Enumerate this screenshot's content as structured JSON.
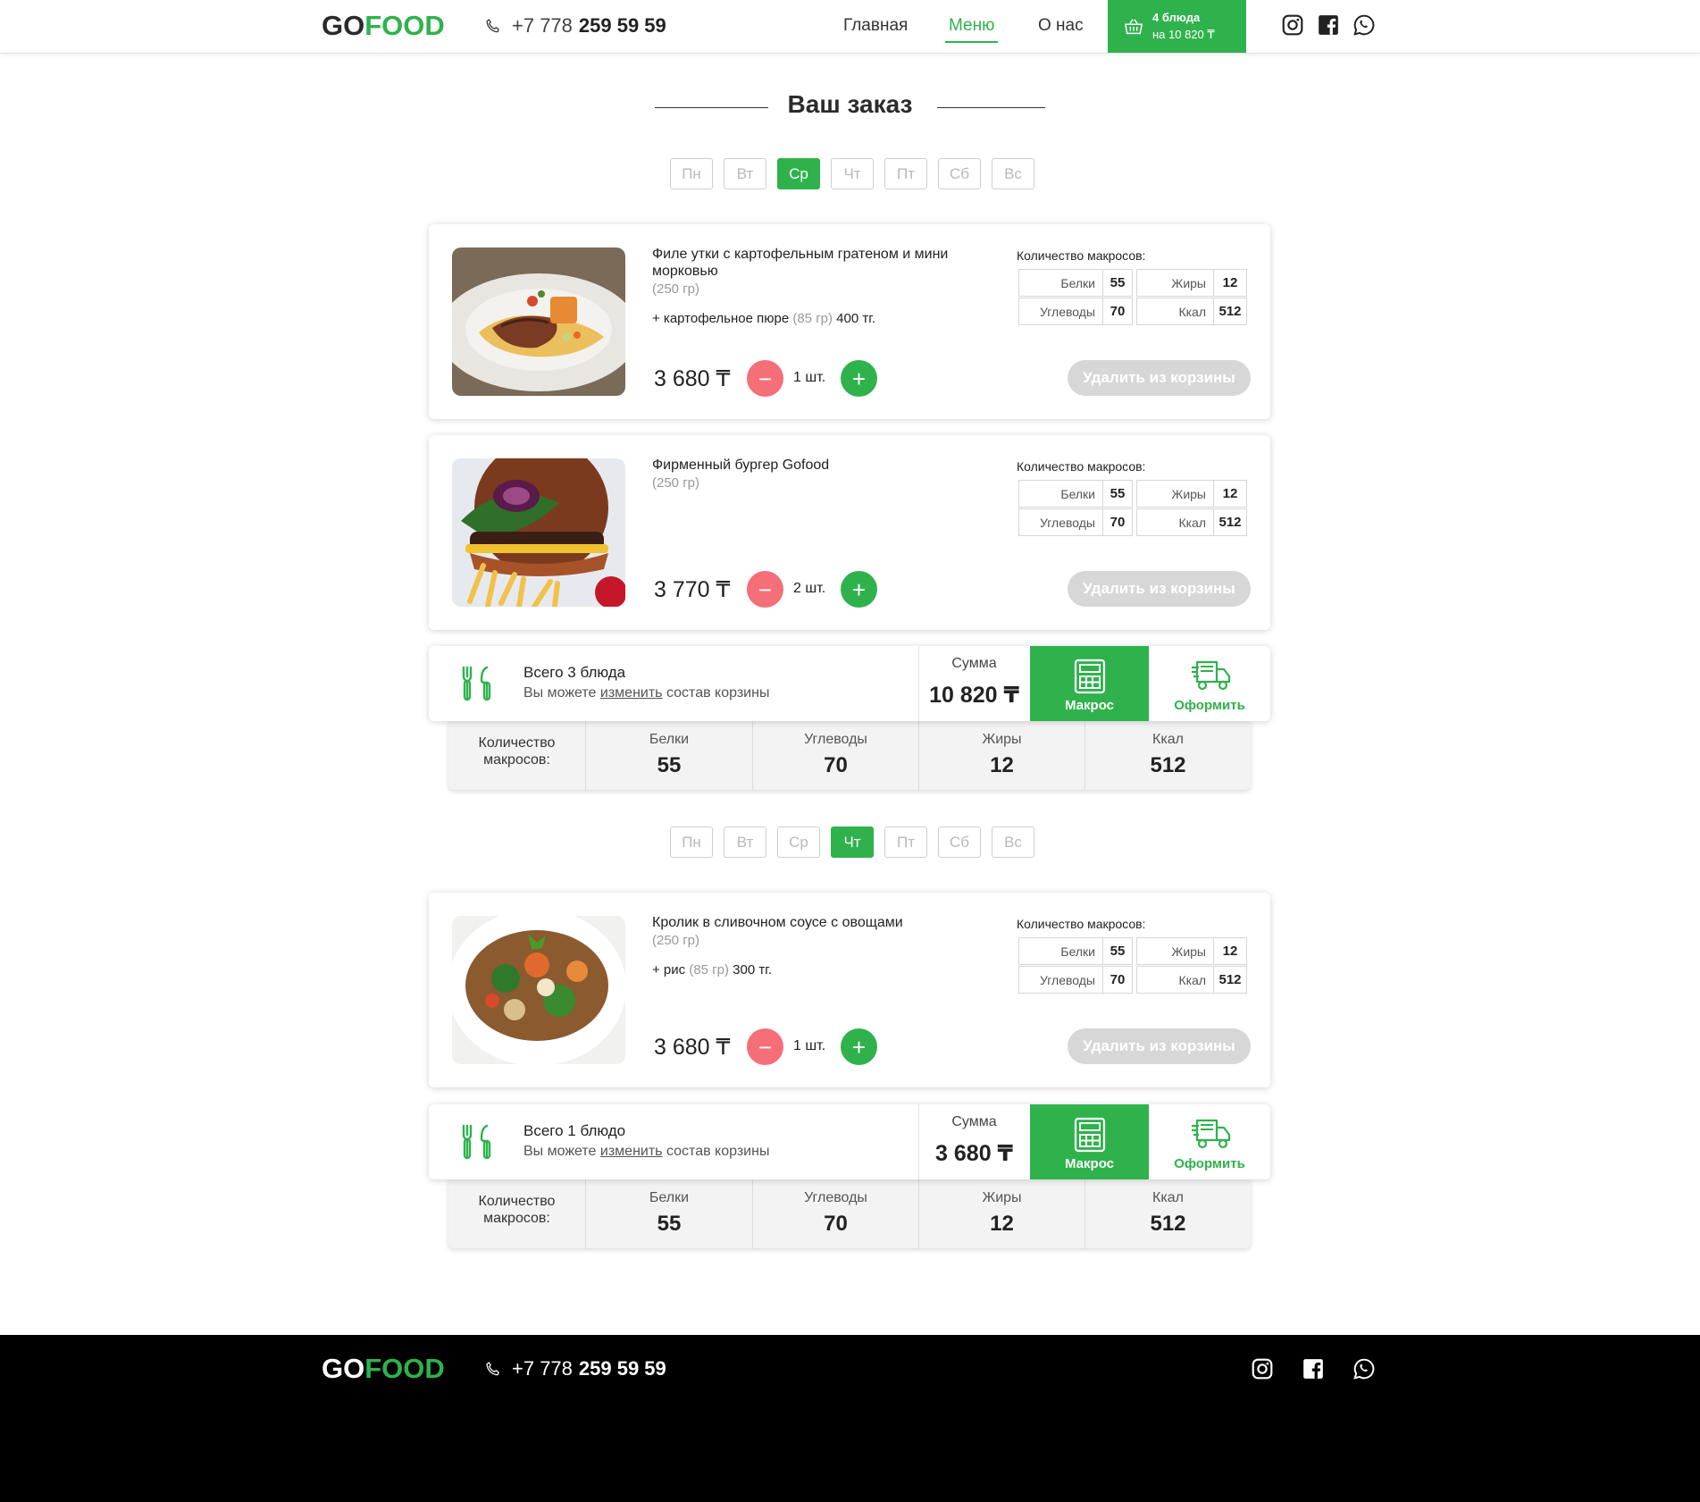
{
  "header": {
    "logo_go": "GO",
    "logo_food": "FOOD",
    "phone_prefix": "+7 778",
    "phone_number": "259 59 59",
    "nav": [
      "Главная",
      "Меню",
      "О нас"
    ],
    "active_nav": "Меню",
    "cart_count": "4 блюда",
    "cart_total": "на 10 820 ₸"
  },
  "page_title": "Ваш заказ",
  "colors": {
    "accent": "#2fb24c",
    "minus": "#f46f78",
    "disabled": "#d7d7d7"
  },
  "days": [
    "Пн",
    "Вт",
    "Ср",
    "Чт",
    "Пт",
    "Сб",
    "Вс"
  ],
  "day_groups": [
    {
      "active_day": "Ср",
      "items": [
        {
          "name": "Филе утки с картофельным гратеном и мини морковью",
          "weight": "(250 гр)",
          "addon_prefix": "+ картофельное пюре",
          "addon_weight": "(85 гр)",
          "addon_price": "400 тг.",
          "price": "3 680 ₸",
          "qty": "1 шт.",
          "remove": "Удалить из корзины",
          "macros_label": "Количество макросов:",
          "macros": {
            "protein_label": "Белки",
            "protein": "55",
            "fat_label": "Жиры",
            "fat": "12",
            "carbs_label": "Углеводы",
            "carbs": "70",
            "kcal_label": "Ккал",
            "kcal": "512"
          },
          "image": "duck-dish"
        },
        {
          "name": "Фирменный бургер Gofood",
          "weight": "(250 гр)",
          "price": "3 770 ₸",
          "qty": "2 шт.",
          "remove": "Удалить из корзины",
          "macros_label": "Количество макросов:",
          "macros": {
            "protein_label": "Белки",
            "protein": "55",
            "fat_label": "Жиры",
            "fat": "12",
            "carbs_label": "Углеводы",
            "carbs": "70",
            "kcal_label": "Ккал",
            "kcal": "512"
          },
          "image": "burger"
        }
      ],
      "summary": {
        "total_dishes": "Всего 3 блюда",
        "note_before": "Вы можете",
        "note_link": "изменить",
        "note_after": "состав корзины",
        "sum_label": "Сумма",
        "sum_value": "10 820 ₸",
        "macros_button": "Макрос",
        "order_button": "Оформить"
      },
      "macro_totals": {
        "label": "Количество макросов:",
        "cols": [
          {
            "k": "Белки",
            "v": "55"
          },
          {
            "k": "Углеводы",
            "v": "70"
          },
          {
            "k": "Жиры",
            "v": "12"
          },
          {
            "k": "Ккал",
            "v": "512"
          }
        ]
      }
    },
    {
      "active_day": "Чт",
      "items": [
        {
          "name": "Кролик в сливочном соусе с овощами",
          "weight": "(250 гр)",
          "addon_prefix": "+ рис",
          "addon_weight": "(85 гр)",
          "addon_price": "300 тг.",
          "price": "3 680 ₸",
          "qty": "1 шт.",
          "remove": "Удалить из корзины",
          "macros_label": "Количество макросов:",
          "macros": {
            "protein_label": "Белки",
            "protein": "55",
            "fat_label": "Жиры",
            "fat": "12",
            "carbs_label": "Углеводы",
            "carbs": "70",
            "kcal_label": "Ккал",
            "kcal": "512"
          },
          "image": "rabbit-stew"
        }
      ],
      "summary": {
        "total_dishes": "Всего 1 блюдо",
        "note_before": "Вы можете",
        "note_link": "изменить",
        "note_after": "состав корзины",
        "sum_label": "Сумма",
        "sum_value": "3 680 ₸",
        "macros_button": "Макрос",
        "order_button": "Оформить"
      },
      "macro_totals": {
        "label": "Количество макросов:",
        "cols": [
          {
            "k": "Белки",
            "v": "55"
          },
          {
            "k": "Углеводы",
            "v": "70"
          },
          {
            "k": "Жиры",
            "v": "12"
          },
          {
            "k": "Ккал",
            "v": "512"
          }
        ]
      }
    }
  ],
  "footer": {
    "logo_go": "GO",
    "logo_food": "FOOD",
    "phone_prefix": "+7 778",
    "phone_number": "259 59 59"
  },
  "icons": [
    "phone-icon",
    "basket-icon",
    "instagram-icon",
    "facebook-icon",
    "whatsapp-icon",
    "cutlery-icon",
    "calculator-icon",
    "delivery-truck-icon"
  ]
}
